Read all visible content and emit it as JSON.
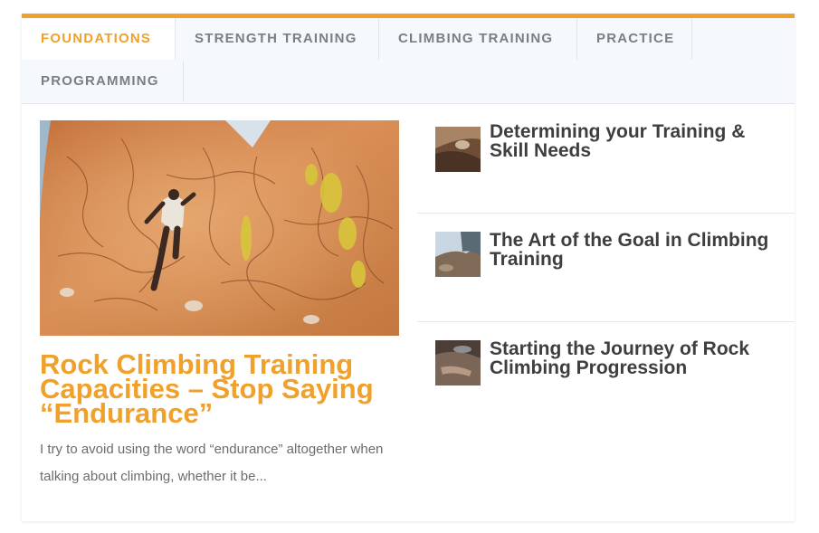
{
  "tabs": [
    {
      "label": "FOUNDATIONS",
      "active": true
    },
    {
      "label": "STRENGTH TRAINING",
      "active": false
    },
    {
      "label": "CLIMBING TRAINING",
      "active": false
    },
    {
      "label": "PRACTICE",
      "active": false
    },
    {
      "label": "PROGRAMMING",
      "active": false
    }
  ],
  "featured": {
    "title": "Rock Climbing Training Capacities – Stop Saying “Endurance”",
    "excerpt": "I try to avoid using the word “endurance” altogether when talking about climbing, whether it be..."
  },
  "side_posts": [
    {
      "title": "Determining your Training & Skill Needs"
    },
    {
      "title": "The Art of the Goal in Climbing Training"
    },
    {
      "title": "Starting the Journey of Rock Climbing Progression"
    }
  ],
  "colors": {
    "accent": "#f0a12b",
    "tab_bar_bg": "#f5f8fc",
    "tab_text": "#7b7f84",
    "title_text": "#3e3e3e",
    "excerpt_text": "#6c6c6c"
  }
}
